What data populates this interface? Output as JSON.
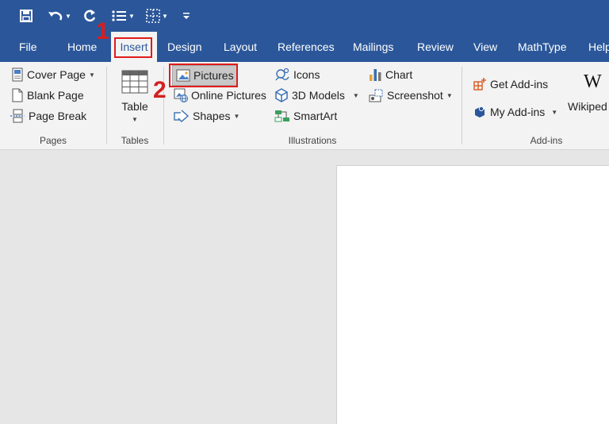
{
  "quick_access": {
    "save_icon": "save-icon",
    "undo_icon": "undo-icon",
    "redo_icon": "redo-icon",
    "bullets_icon": "bullets-icon",
    "borders_icon": "borders-icon",
    "customize_icon": "customize-icon"
  },
  "tabs": [
    {
      "label": "File"
    },
    {
      "label": "Home"
    },
    {
      "label": "Insert"
    },
    {
      "label": "Design"
    },
    {
      "label": "Layout"
    },
    {
      "label": "References"
    },
    {
      "label": "Mailings"
    },
    {
      "label": "Review"
    },
    {
      "label": "View"
    },
    {
      "label": "MathType"
    },
    {
      "label": "Help"
    }
  ],
  "ribbon": {
    "pages": {
      "label": "Pages",
      "cover_page": "Cover Page",
      "blank_page": "Blank Page",
      "page_break": "Page Break"
    },
    "tables": {
      "label": "Tables",
      "table": "Table"
    },
    "illustrations": {
      "label": "Illustrations",
      "pictures": "Pictures",
      "online_pictures": "Online Pictures",
      "shapes": "Shapes",
      "icons": "Icons",
      "models_3d": "3D Models",
      "smartart": "SmartArt",
      "chart": "Chart",
      "screenshot": "Screenshot"
    },
    "addins": {
      "label": "Add-ins",
      "get_addins": "Get Add-ins",
      "my_addins": "My Add-ins",
      "wikipedia_logo": "W",
      "wikipedia": "Wikiped"
    }
  },
  "annotations": {
    "step1": "1",
    "step2": "2"
  },
  "colors": {
    "ribbon_blue": "#2b579a",
    "highlight_red": "#e21b1b"
  }
}
